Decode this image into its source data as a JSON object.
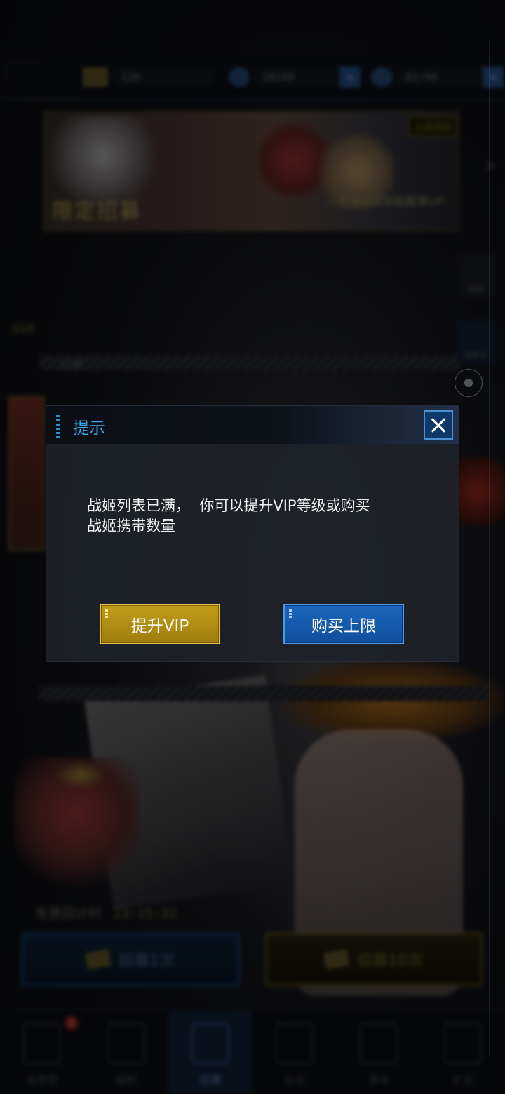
{
  "topbar": {
    "resources": [
      {
        "icon": "ticket-icon",
        "value": "120"
      },
      {
        "icon": "diamond-icon",
        "value": "20180"
      },
      {
        "icon": "gear-coin-icon",
        "value": "82/90"
      }
    ]
  },
  "banner": {
    "title": "限定招募",
    "subtitle": "心愿单战姬获取概率UP!",
    "tag": "上线活动"
  },
  "background": {
    "side_buttons": [
      "说明",
      "战姬手"
    ],
    "ssr_label": "SSR",
    "record_label": "记录",
    "timer_label": "免费招计时",
    "timer_value": "23:15:32",
    "recruit_once": "招募1次",
    "recruit_ten": "招募10次"
  },
  "nav": {
    "items": [
      "指挥室",
      "编制",
      "招募",
      "出击",
      "基地",
      "扩张"
    ],
    "active": 2,
    "badge": "1"
  },
  "dialog": {
    "title": "提示",
    "message_line1": "战姬列表已满，  你可以提升VIP等级或购买",
    "message_line2": "战姬携带数量",
    "btn_vip": "提升VIP",
    "btn_buy": "购买上限"
  },
  "colors": {
    "title_blue": "#3aa5e6",
    "vip_gold": "#c29d18",
    "buy_blue": "#1b67bd",
    "close_blue": "#0f3868"
  }
}
